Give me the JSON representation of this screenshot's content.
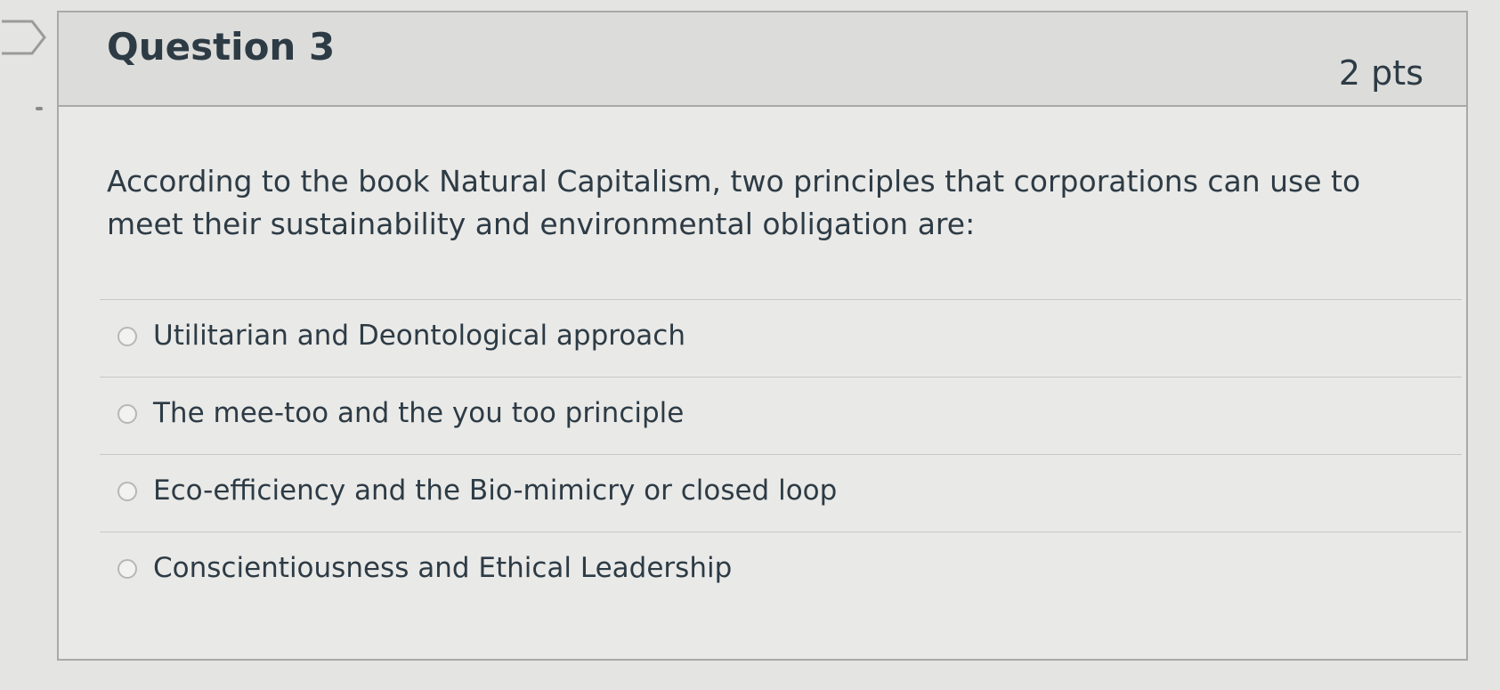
{
  "question": {
    "title": "Question 3",
    "points": "2 pts",
    "text": "According to the book Natural Capitalism, two principles that corporations can use to meet their sustainability and environmental obligation are:"
  },
  "answers": [
    {
      "label": "Utilitarian and Deontological approach"
    },
    {
      "label": "The mee-too and the you too principle"
    },
    {
      "label": "Eco-efficiency and the Bio-mimicry or closed loop"
    },
    {
      "label": "Conscientiousness and Ethical Leadership"
    }
  ],
  "colors": {
    "text": "#2d3b45",
    "border": "#a9aaa8",
    "header_bg": "#dcdcda",
    "card_bg": "#e9e9e7"
  },
  "icons": {
    "flag": "flag-question-icon",
    "radio": "radio-unchecked-icon"
  }
}
